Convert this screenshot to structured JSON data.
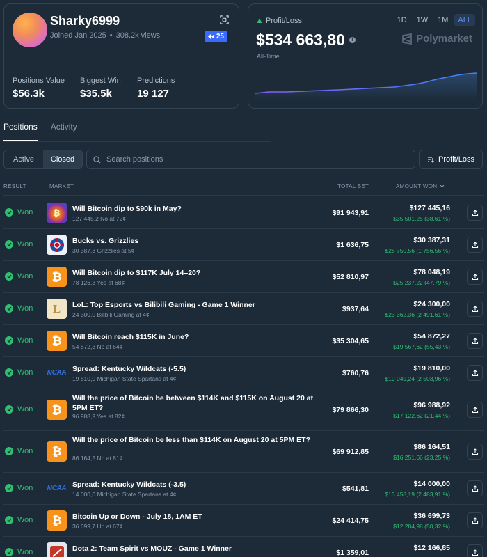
{
  "profile": {
    "username": "Sharky6999",
    "joined": "Joined Jan 2025",
    "views": "308.2k views",
    "rank_badge": "25",
    "stats": [
      {
        "label": "Positions Value",
        "value": "$56.3k"
      },
      {
        "label": "Biggest Win",
        "value": "$35.5k"
      },
      {
        "label": "Predictions",
        "value": "19 127"
      }
    ]
  },
  "pnl": {
    "label": "Profit/Loss",
    "value": "$534 663,80",
    "period": "All-Time",
    "ranges": [
      "1D",
      "1W",
      "1M",
      "ALL"
    ],
    "active_range": "ALL",
    "brand": "Polymarket",
    "line_color": "#8b5cf6",
    "line_color_end": "#3b82f6"
  },
  "tabs": [
    {
      "label": "Positions",
      "active": true
    },
    {
      "label": "Activity",
      "active": false
    }
  ],
  "filters": {
    "segments": [
      {
        "label": "Active",
        "active": false
      },
      {
        "label": "Closed",
        "active": true
      }
    ],
    "search_placeholder": "Search positions",
    "sort_label": "Profit/Loss"
  },
  "table": {
    "headers": {
      "result": "RESULT",
      "market": "MARKET",
      "total_bet": "TOTAL BET",
      "amount_won": "AMOUNT WON"
    },
    "rows": [
      {
        "result": "Won",
        "icon": "bitcoin-art-icon",
        "title": "Will Bitcoin dip to $90k in May?",
        "sub": "127 445,2 No at 72¢",
        "bet": "$91 943,91",
        "amount": "$127 445,16",
        "gain": "$35 501,25 (38,61 %)"
      },
      {
        "result": "Won",
        "icon": "nba-icon",
        "title": "Bucks vs. Grizzlies",
        "sub": "30 387,3 Grizzlies at 5¢",
        "bet": "$1 636,75",
        "amount": "$30 387,31",
        "gain": "$28 750,56 (1 756,56 %)"
      },
      {
        "result": "Won",
        "icon": "bitcoin-icon",
        "title": "Will Bitcoin dip to $117K July 14–20?",
        "sub": "78 126,3 Yes at 68¢",
        "bet": "$52 810,97",
        "amount": "$78 048,19",
        "gain": "$25 237,22 (47,79 %)"
      },
      {
        "result": "Won",
        "icon": "lol-icon",
        "title": "LoL: Top Esports vs Bilibili Gaming - Game 1 Winner",
        "sub": "24 300,0 Bilibili Gaming at 4¢",
        "bet": "$937,64",
        "amount": "$24 300,00",
        "gain": "$23 362,36 (2 491,61 %)"
      },
      {
        "result": "Won",
        "icon": "bitcoin-icon",
        "title": "Will Bitcoin reach $115K in June?",
        "sub": "54 872,3 No at 64¢",
        "bet": "$35 304,65",
        "amount": "$54 872,27",
        "gain": "$19 567,62 (55,43 %)"
      },
      {
        "result": "Won",
        "icon": "ncaa-icon",
        "title": "Spread: Kentucky Wildcats (-5.5)",
        "sub": "19 810,0 Michigan State Spartans at 4¢",
        "bet": "$760,76",
        "amount": "$19 810,00",
        "gain": "$19 049,24 (2 503,96 %)"
      },
      {
        "result": "Won",
        "icon": "bitcoin-icon",
        "title": "Will the price of Bitcoin be between $114K and $115K on August 20 at 5PM ET?",
        "sub": "96 988,9 Yes at 82¢",
        "bet": "$79 866,30",
        "amount": "$96 988,92",
        "gain": "$17 122,62 (21,44 %)"
      },
      {
        "result": "Won",
        "icon": "bitcoin-icon",
        "title": "Will the price of Bitcoin be less than $114K on August 20 at 5PM ET?",
        "sub": "86 164,5 No at 81¢",
        "bet": "$69 912,85",
        "amount": "$86 164,51",
        "gain": "$16 251,66 (23,25 %)"
      },
      {
        "result": "Won",
        "icon": "ncaa-icon",
        "title": "Spread: Kentucky Wildcats (-3.5)",
        "sub": "14 000,0 Michigan State Spartans at 4¢",
        "bet": "$541,81",
        "amount": "$14 000,00",
        "gain": "$13 458,19 (2 483,91 %)"
      },
      {
        "result": "Won",
        "icon": "bitcoin-icon",
        "title": "Bitcoin Up or Down - July 18, 1AM ET",
        "sub": "36 699,7 Up at 67¢",
        "bet": "$24 414,75",
        "amount": "$36 699,73",
        "gain": "$12 284,98 (50,32 %)"
      },
      {
        "result": "Won",
        "icon": "dota-icon",
        "title": "Dota 2: Team Spirit vs MOUZ - Game 1 Winner",
        "sub": "",
        "bet": "$1 359,01",
        "amount": "$12 166,85",
        "gain": ""
      }
    ]
  }
}
